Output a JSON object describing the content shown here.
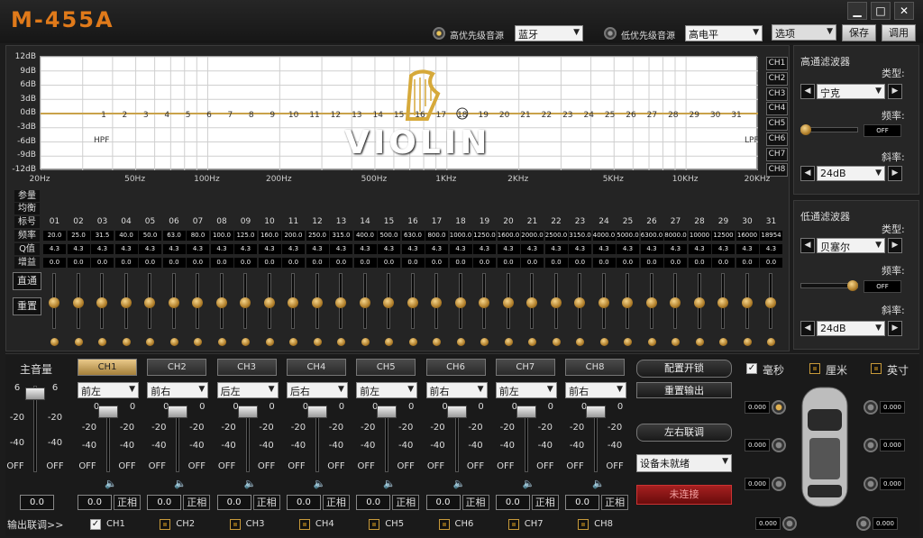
{
  "app": {
    "title": "M-455A"
  },
  "top": {
    "high_src_label": "高优先级音源",
    "high_src_value": "蓝牙",
    "low_src_label": "低优先级音源",
    "low_src_value": "高电平",
    "options": "选项",
    "save": "保存",
    "load": "调用"
  },
  "graph": {
    "y_labels": [
      "12dB",
      "9dB",
      "6dB",
      "3dB",
      "0dB",
      "-3dB",
      "-6dB",
      "-9dB",
      "-12dB"
    ],
    "x_labels": [
      "20Hz",
      "50Hz",
      "100Hz",
      "200Hz",
      "500Hz",
      "1KHz",
      "2KHz",
      "5KHz",
      "10KHz",
      "20KHz"
    ],
    "point_numbers": [
      "1",
      "2",
      "3",
      "4",
      "5",
      "6",
      "7",
      "8",
      "9",
      "10",
      "11",
      "12",
      "13",
      "14",
      "15",
      "16",
      "17",
      "18",
      "19",
      "20",
      "21",
      "22",
      "23",
      "24",
      "25",
      "26",
      "27",
      "28",
      "29",
      "30",
      "31"
    ],
    "hpf": "HPF",
    "lpf": "LPF",
    "logo": "VIOLIN",
    "channels": [
      "CH1",
      "CH2",
      "CH3",
      "CH4",
      "CH5",
      "CH6",
      "CH7",
      "CH8"
    ]
  },
  "hpf_panel": {
    "title": "高通滤波器",
    "type_label": "类型:",
    "type_value": "宁克",
    "freq_label": "频率:",
    "freq_value": "OFF",
    "slope_label": "斜率:",
    "slope_value": "24dB"
  },
  "lpf_panel": {
    "title": "低通滤波器",
    "type_label": "类型:",
    "type_value": "贝塞尔",
    "freq_label": "频率:",
    "freq_value": "OFF",
    "slope_label": "斜率:",
    "slope_value": "24dB"
  },
  "eq": {
    "tab_param": "参量",
    "tab_eq": "均衡",
    "row_label": "标号",
    "row_freq": "频率",
    "row_q": "Q值",
    "row_gain": "增益",
    "bypass": "直通",
    "reset": "重置",
    "bands": [
      "01",
      "02",
      "03",
      "04",
      "05",
      "06",
      "07",
      "08",
      "09",
      "10",
      "11",
      "12",
      "13",
      "14",
      "15",
      "16",
      "17",
      "18",
      "19",
      "20",
      "21",
      "22",
      "23",
      "24",
      "25",
      "26",
      "27",
      "28",
      "29",
      "30",
      "31"
    ],
    "freqs": [
      "20.0",
      "25.0",
      "31.5",
      "40.0",
      "50.0",
      "63.0",
      "80.0",
      "100.0",
      "125.0",
      "160.0",
      "200.0",
      "250.0",
      "315.0",
      "400.0",
      "500.0",
      "630.0",
      "800.0",
      "1000.0",
      "1250.0",
      "1600.0",
      "2000.0",
      "2500.0",
      "3150.0",
      "4000.0",
      "5000.0",
      "6300.0",
      "8000.0",
      "10000",
      "12500",
      "16000",
      "18954"
    ],
    "q": "4.3",
    "gain": "0.0"
  },
  "master": {
    "label": "主音量",
    "top": "6",
    "m20": "-20",
    "m40": "-40",
    "off": "OFF",
    "value": "0.0"
  },
  "channels": [
    {
      "name": "CH1",
      "pos": "前左",
      "val": "0.0",
      "phase": "正相",
      "active": true
    },
    {
      "name": "CH2",
      "pos": "前右",
      "val": "0.0",
      "phase": "正相"
    },
    {
      "name": "CH3",
      "pos": "后左",
      "val": "0.0",
      "phase": "正相"
    },
    {
      "name": "CH4",
      "pos": "后右",
      "val": "0.0",
      "phase": "正相"
    },
    {
      "name": "CH5",
      "pos": "前左",
      "val": "0.0",
      "phase": "正相"
    },
    {
      "name": "CH6",
      "pos": "前右",
      "val": "0.0",
      "phase": "正相"
    },
    {
      "name": "CH7",
      "pos": "前左",
      "val": "0.0",
      "phase": "正相"
    },
    {
      "name": "CH8",
      "pos": "前右",
      "val": "0.0",
      "phase": "正相"
    }
  ],
  "scale": {
    "zero": "0",
    "m20": "-20",
    "m40": "-40",
    "off": "OFF"
  },
  "link": {
    "label": "输出联调>>",
    "items": [
      "CH1",
      "CH2",
      "CH3",
      "CH4",
      "CH5",
      "CH6",
      "CH7",
      "CH8"
    ]
  },
  "right": {
    "cfg_lock": "配置开锁",
    "reset_out": "重置输出",
    "lr_link": "左右联调",
    "device": "设备未就绪",
    "conn": "未连接",
    "unit_ms": "毫秒",
    "unit_cm": "厘米",
    "unit_in": "英寸",
    "delays": [
      "0.000",
      "0.000",
      "0.000",
      "0.000",
      "0.000",
      "0.000",
      "0.000",
      "0.000",
      "0.000",
      "0.000"
    ]
  }
}
